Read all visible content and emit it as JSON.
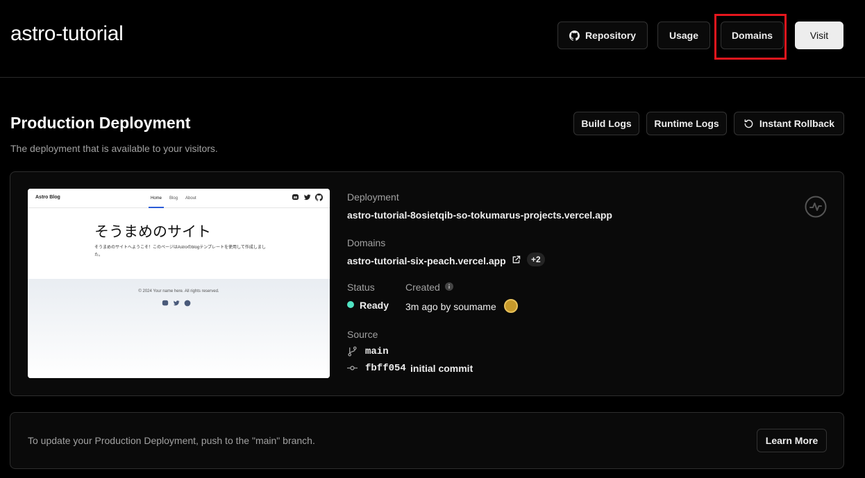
{
  "header": {
    "title": "astro-tutorial",
    "repository_label": "Repository",
    "usage_label": "Usage",
    "domains_label": "Domains",
    "visit_label": "Visit"
  },
  "section": {
    "title": "Production Deployment",
    "subtitle": "The deployment that is available to your visitors.",
    "build_logs_label": "Build Logs",
    "runtime_logs_label": "Runtime Logs",
    "instant_rollback_label": "Instant Rollback"
  },
  "preview": {
    "brand": "Astro Blog",
    "nav": [
      "Home",
      "Blog",
      "About"
    ],
    "hero_title": "そうまめのサイト",
    "hero_text": "そうまめのサイトへようこそ！このページはAstroのblogテンプレートを使用して作成しました。",
    "copyright": "© 2024 Your name here. All rights reserved."
  },
  "deployment": {
    "deployment_label": "Deployment",
    "deployment_url": "astro-tutorial-8osietqib-so-tokumarus-projects.vercel.app",
    "domains_label": "Domains",
    "domain_url": "astro-tutorial-six-peach.vercel.app",
    "domains_extra": "+2",
    "status_label": "Status",
    "status_value": "Ready",
    "status_color": "#50e3c2",
    "created_label": "Created",
    "created_value": "3m ago by soumame",
    "source_label": "Source",
    "branch": "main",
    "commit_hash": "fbff054",
    "commit_message": "initial commit"
  },
  "info": {
    "text": "To update your Production Deployment, push to the \"main\" branch.",
    "learn_more_label": "Learn More"
  },
  "colors": {
    "highlight": "#e5161d",
    "background": "#000000"
  }
}
